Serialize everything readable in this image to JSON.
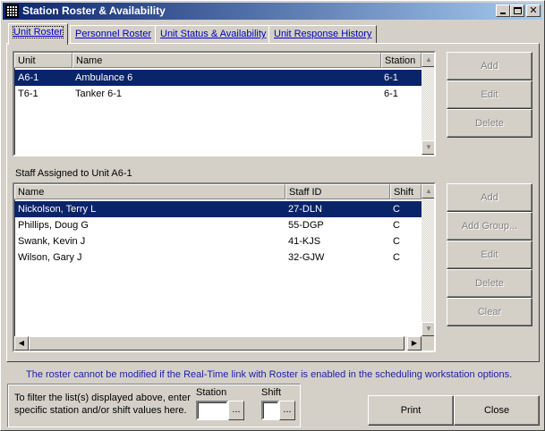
{
  "window": {
    "title": "Station Roster & Availability",
    "app_icon": "grid-icon"
  },
  "tabs": [
    {
      "label": "Unit Roster",
      "active": true
    },
    {
      "label": "Personnel Roster",
      "active": false
    },
    {
      "label": "Unit Status & Availability",
      "active": false
    },
    {
      "label": "Unit Response History",
      "active": false
    }
  ],
  "units_list": {
    "columns": [
      "Unit",
      "Name",
      "Station"
    ],
    "rows": [
      {
        "unit": "A6-1",
        "name": "Ambulance 6",
        "station": "6-1",
        "selected": true
      },
      {
        "unit": "T6-1",
        "name": "Tanker 6-1",
        "station": "6-1",
        "selected": false
      }
    ]
  },
  "units_buttons": {
    "add": "Add",
    "edit": "Edit",
    "delete": "Delete"
  },
  "staff_section_label": "Staff Assigned to Unit A6-1",
  "staff_list": {
    "columns": [
      "Name",
      "Staff ID",
      "Shift"
    ],
    "rows": [
      {
        "name": "Nickolson, Terry L",
        "staff_id": "27-DLN",
        "shift": "C",
        "selected": true
      },
      {
        "name": "Phillips, Doug G",
        "staff_id": "55-DGP",
        "shift": "C",
        "selected": false
      },
      {
        "name": "Swank, Kevin J",
        "staff_id": "41-KJS",
        "shift": "C",
        "selected": false
      },
      {
        "name": "Wilson, Gary J",
        "staff_id": "32-GJW",
        "shift": "C",
        "selected": false
      }
    ]
  },
  "staff_buttons": {
    "add": "Add",
    "add_group": "Add Group...",
    "edit": "Edit",
    "delete": "Delete",
    "clear": "Clear"
  },
  "notice": "The roster cannot be modified if the Real-Time link with Roster is enabled in the scheduling workstation options.",
  "filter": {
    "instructions_line1": "To filter the list(s) displayed above, enter",
    "instructions_line2": "specific station and/or shift values here.",
    "station_label": "Station",
    "station_value": "",
    "shift_label": "Shift",
    "shift_value": "",
    "browse_label": "..."
  },
  "footer_buttons": {
    "print": "Print",
    "close": "Close"
  },
  "colors": {
    "selection": "#0a246a",
    "notice_text": "#1c1ca8",
    "tab_text": "#0000c0"
  }
}
